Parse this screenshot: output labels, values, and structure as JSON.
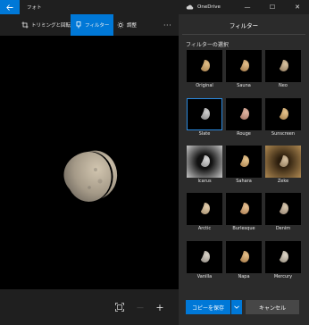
{
  "window": {
    "app_title": "フォト",
    "onedrive_label": "OneDrive",
    "minimize_glyph": "—",
    "maximize_glyph": "☐",
    "close_glyph": "✕"
  },
  "toolbar": {
    "crop_label": "トリミングと回転",
    "filter_label": "フィルター",
    "adjust_label": "調整",
    "more_glyph": "···"
  },
  "panel": {
    "title": "フィルター",
    "section_title": "フィルターの選択",
    "filters": [
      {
        "label": "Original"
      },
      {
        "label": "Sauna"
      },
      {
        "label": "Neo"
      },
      {
        "label": "Slate"
      },
      {
        "label": "Rouge"
      },
      {
        "label": "Sunscreen"
      },
      {
        "label": "Icarus"
      },
      {
        "label": "Sahara"
      },
      {
        "label": "Zeke"
      },
      {
        "label": "Arctic"
      },
      {
        "label": "Burlesque"
      },
      {
        "label": "Denim"
      },
      {
        "label": "Vanilla"
      },
      {
        "label": "Napa"
      },
      {
        "label": "Mercury"
      }
    ],
    "selected_filter": "Slate",
    "save_copy_label": "コピーを保存",
    "cancel_label": "キャンセル"
  },
  "bottom_bar": {
    "minus_glyph": "—",
    "plus_glyph": "+"
  },
  "colors": {
    "accent": "#0078d7",
    "panel_bg": "#2b2b2b",
    "window_bg": "#1f1f1f"
  }
}
